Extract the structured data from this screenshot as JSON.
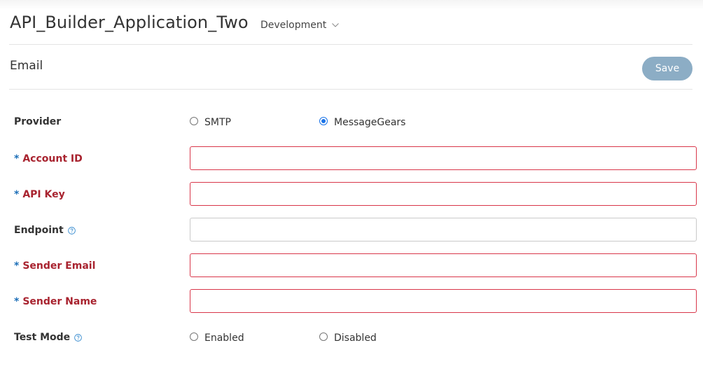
{
  "header": {
    "app_title": "API_Builder_Application_Two",
    "environment": "Development"
  },
  "section": {
    "title": "Email",
    "save_label": "Save"
  },
  "form": {
    "provider": {
      "label": "Provider",
      "options": [
        "SMTP",
        "MessageGears"
      ],
      "selected": "MessageGears"
    },
    "account_id": {
      "required_mark": "*",
      "label": "Account ID",
      "value": "",
      "required": true
    },
    "api_key": {
      "required_mark": "*",
      "label": "API Key",
      "value": "",
      "required": true
    },
    "endpoint": {
      "label": "Endpoint",
      "value": "",
      "required": false,
      "help_icon": "help-circle-icon"
    },
    "sender_email": {
      "required_mark": "*",
      "label": "Sender Email",
      "value": "",
      "required": true
    },
    "sender_name": {
      "required_mark": "*",
      "label": "Sender Name",
      "value": "",
      "required": true
    },
    "test_mode": {
      "label": "Test Mode",
      "help_icon": "help-circle-icon",
      "options": [
        "Enabled",
        "Disabled"
      ],
      "selected": ""
    }
  },
  "colors": {
    "required_label": "#a8232f",
    "required_star": "#1d6fb8",
    "invalid_border": "#d9364a",
    "save_button": "#8cadc5",
    "radio_checked": "#1a73e8"
  }
}
